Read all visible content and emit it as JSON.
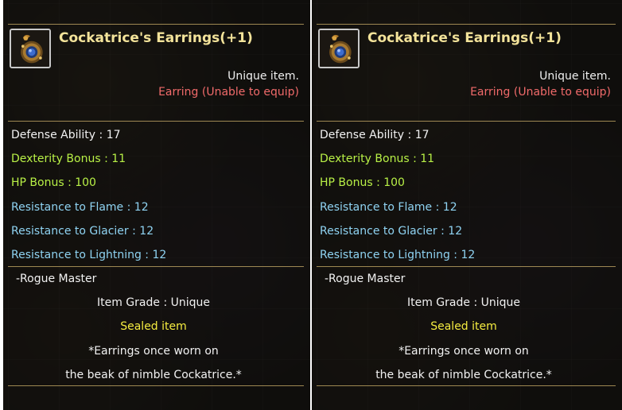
{
  "tooltips": [
    {
      "item_name": "Cockatrice's Earrings(+1)",
      "rarity_label": "Unique item.",
      "slot_label": "Earring (Unable to equip)",
      "stats": [
        {
          "text": "Defense Ability : 17",
          "color": "#f2f2f2"
        },
        {
          "text": "Dexterity Bonus : 11",
          "color": "#b8f046"
        },
        {
          "text": "HP Bonus : 100",
          "color": "#b8f046"
        },
        {
          "text": "Resistance to Flame : 12",
          "color": "#8fd3f2"
        },
        {
          "text": "Resistance to Glacier : 12",
          "color": "#8fd3f2"
        },
        {
          "text": "Resistance to Lightning : 12",
          "color": "#8fd3f2"
        }
      ],
      "class_restriction": "-Rogue Master",
      "item_grade": "Item Grade : Unique",
      "sealed_label": "Sealed item",
      "description_line1": "*Earrings once worn on",
      "description_line2": "the beak of nimble Cockatrice.*",
      "icon": "earring-icon"
    },
    {
      "item_name": "Cockatrice's Earrings(+1)",
      "rarity_label": "Unique item.",
      "slot_label": "Earring (Unable to equip)",
      "stats": [
        {
          "text": "Defense Ability : 17",
          "color": "#f2f2f2"
        },
        {
          "text": "Dexterity Bonus : 11",
          "color": "#b8f046"
        },
        {
          "text": "HP Bonus : 100",
          "color": "#b8f046"
        },
        {
          "text": "Resistance to Flame : 12",
          "color": "#8fd3f2"
        },
        {
          "text": "Resistance to Glacier : 12",
          "color": "#8fd3f2"
        },
        {
          "text": "Resistance to Lightning : 12",
          "color": "#8fd3f2"
        }
      ],
      "class_restriction": "-Rogue Master",
      "item_grade": "Item Grade : Unique",
      "sealed_label": "Sealed item",
      "description_line1": "*Earrings once worn on",
      "description_line2": "the beak of nimble Cockatrice.*",
      "icon": "earring-icon"
    }
  ],
  "colors": {
    "title": "#f3e39a",
    "slot_warning": "#f06a6a",
    "sealed": "#f5ec40",
    "divider": "#b79e5f"
  }
}
